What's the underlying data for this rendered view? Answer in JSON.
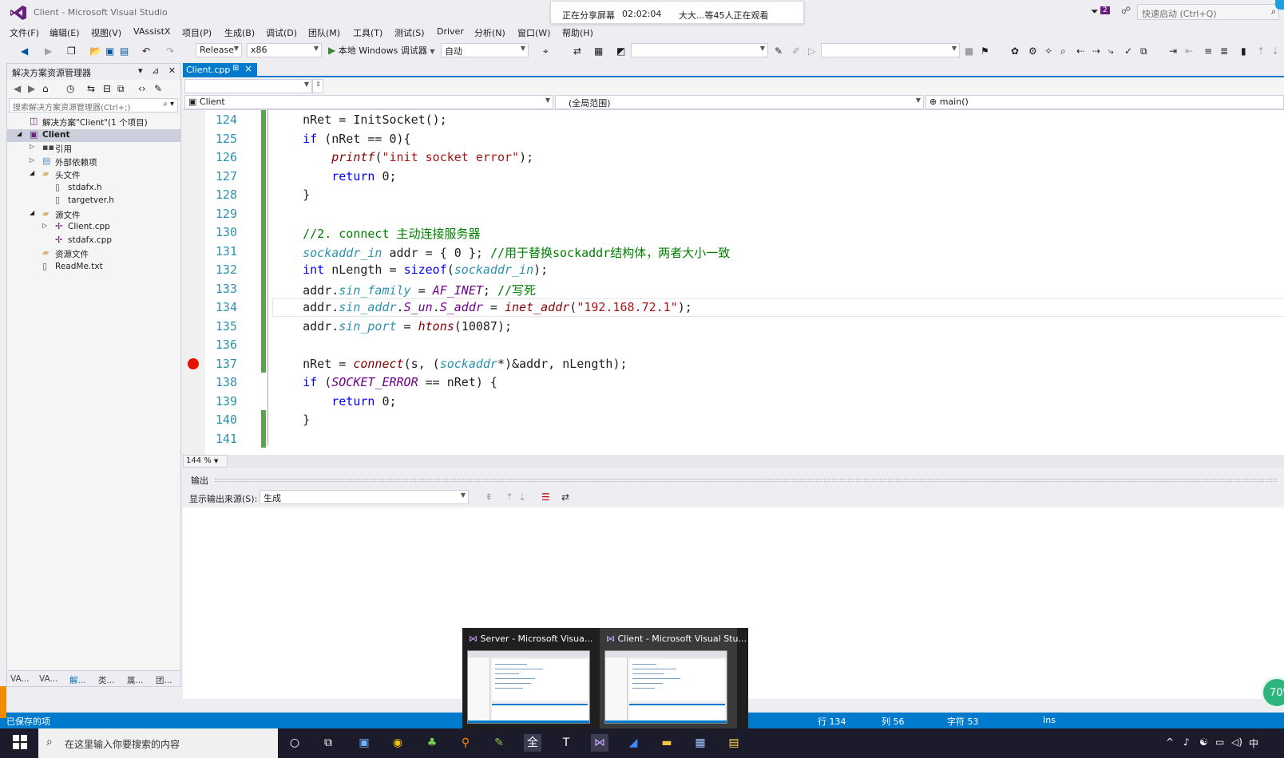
{
  "window": {
    "title": "Client - Microsoft Visual Studio"
  },
  "share_banner": {
    "status": "正在分享屏幕",
    "timer": "02:02:04",
    "viewers": "大大...等45人正在观看"
  },
  "title_right": {
    "notifications": "2",
    "quick_launch_placeholder": "快速启动 (Ctrl+Q)"
  },
  "menu": [
    "文件(F)",
    "编辑(E)",
    "视图(V)",
    "VAssistX",
    "项目(P)",
    "生成(B)",
    "调试(D)",
    "团队(M)",
    "工具(T)",
    "测试(S)",
    "Driver",
    "分析(N)",
    "窗口(W)",
    "帮助(H)"
  ],
  "toolbar": {
    "config": "Release",
    "platform": "x86",
    "debugger": "本地 Windows 调试器",
    "auto": "自动"
  },
  "solution_explorer": {
    "title": "解决方案资源管理器",
    "search_placeholder": "搜索解决方案资源管理器(Ctrl+;)",
    "items": [
      {
        "label": "解决方案\"Client\"(1 个项目)",
        "icon": "solution-icon",
        "level": 0,
        "expander": ""
      },
      {
        "label": "Client",
        "icon": "project-icon",
        "level": 0,
        "expander": "expanded",
        "selected": true,
        "bold": true
      },
      {
        "label": "引用",
        "icon": "references-icon",
        "level": 1,
        "expander": "collapsed"
      },
      {
        "label": "外部依赖项",
        "icon": "external-deps-icon",
        "level": 1,
        "expander": "collapsed"
      },
      {
        "label": "头文件",
        "icon": "folder-icon",
        "level": 1,
        "expander": "expanded"
      },
      {
        "label": "stdafx.h",
        "icon": "header-file-icon",
        "level": 2,
        "expander": ""
      },
      {
        "label": "targetver.h",
        "icon": "header-file-icon",
        "level": 2,
        "expander": ""
      },
      {
        "label": "源文件",
        "icon": "folder-icon",
        "level": 1,
        "expander": "expanded"
      },
      {
        "label": "Client.cpp",
        "icon": "cpp-file-icon",
        "level": 2,
        "expander": "collapsed"
      },
      {
        "label": "stdafx.cpp",
        "icon": "cpp-file-icon",
        "level": 2,
        "expander": ""
      },
      {
        "label": "资源文件",
        "icon": "folder-icon",
        "level": 1,
        "expander": ""
      },
      {
        "label": "ReadMe.txt",
        "icon": "text-file-icon",
        "level": 1,
        "expander": ""
      }
    ],
    "bottom_tabs": [
      "VA...",
      "VA...",
      "解...",
      "类...",
      "属...",
      "团..."
    ]
  },
  "editor": {
    "tab": "Client.cpp",
    "nav_project": "Client",
    "nav_scope": "(全局范围)",
    "nav_member": "main()",
    "zoom": "144 %",
    "lines": [
      {
        "n": "124",
        "changed": true,
        "code": [
          [
            "",
            "    nRet = InitSocket();"
          ]
        ]
      },
      {
        "n": "125",
        "changed": true,
        "code": [
          [
            "kw",
            "    if"
          ],
          [
            "",
            " (nRet == 0){"
          ]
        ]
      },
      {
        "n": "126",
        "changed": true,
        "code": [
          [
            "fn",
            "        printf"
          ],
          [
            "",
            "("
          ],
          [
            "str",
            "\"init socket error\""
          ],
          [
            "",
            ");"
          ]
        ]
      },
      {
        "n": "127",
        "changed": true,
        "code": [
          [
            "kw",
            "        return"
          ],
          [
            "",
            " 0;"
          ]
        ]
      },
      {
        "n": "128",
        "changed": true,
        "code": [
          [
            "",
            "    }"
          ]
        ]
      },
      {
        "n": "129",
        "changed": true,
        "code": [
          [
            "",
            ""
          ]
        ]
      },
      {
        "n": "130",
        "changed": true,
        "code": [
          [
            "cmt",
            "    //2. connect 主动连接服务器"
          ]
        ]
      },
      {
        "n": "131",
        "changed": true,
        "code": [
          [
            "ty",
            "    sockaddr_in"
          ],
          [
            "",
            " addr = { 0 }; "
          ],
          [
            "cmt",
            "//用于替换sockaddr结构体，两者大小一致"
          ]
        ]
      },
      {
        "n": "132",
        "changed": true,
        "code": [
          [
            "kw",
            "    int"
          ],
          [
            "",
            " nLength = "
          ],
          [
            "kw",
            "sizeof"
          ],
          [
            "",
            "("
          ],
          [
            "ty",
            "sockaddr_in"
          ],
          [
            "",
            ");"
          ]
        ]
      },
      {
        "n": "133",
        "changed": true,
        "code": [
          [
            "",
            "    addr."
          ],
          [
            "mem",
            "sin_family"
          ],
          [
            "",
            " = "
          ],
          [
            "mac",
            "AF_INET"
          ],
          [
            "",
            "; "
          ],
          [
            "cmt",
            "//写死"
          ]
        ]
      },
      {
        "n": "134",
        "changed": true,
        "current": true,
        "code": [
          [
            "",
            "    addr."
          ],
          [
            "mem",
            "sin_addr"
          ],
          [
            "",
            "."
          ],
          [
            "mac",
            "S_un"
          ],
          [
            "",
            "."
          ],
          [
            "mac",
            "S_addr"
          ],
          [
            "",
            " = "
          ],
          [
            "fn",
            "inet_addr"
          ],
          [
            "",
            "("
          ],
          [
            "str",
            "\"192.168.72.1\""
          ],
          [
            "",
            ");"
          ]
        ]
      },
      {
        "n": "135",
        "changed": true,
        "code": [
          [
            "",
            "    addr."
          ],
          [
            "mem",
            "sin_port"
          ],
          [
            "",
            " = "
          ],
          [
            "fn",
            "htons"
          ],
          [
            "",
            "(10087);"
          ]
        ]
      },
      {
        "n": "136",
        "changed": true,
        "code": [
          [
            "",
            ""
          ]
        ]
      },
      {
        "n": "137",
        "changed": true,
        "breakpoint": true,
        "code": [
          [
            "",
            "    nRet = "
          ],
          [
            "fn",
            "connect"
          ],
          [
            "",
            "(s, ("
          ],
          [
            "ty",
            "sockaddr"
          ],
          [
            "",
            "*)&addr, nLength);"
          ]
        ]
      },
      {
        "n": "138",
        "changed": false,
        "code": [
          [
            "kw",
            "    if"
          ],
          [
            "",
            " ("
          ],
          [
            "mac",
            "SOCKET_ERROR"
          ],
          [
            "",
            " == nRet) {"
          ]
        ]
      },
      {
        "n": "139",
        "changed": false,
        "code": [
          [
            "kw",
            "        return"
          ],
          [
            "",
            " 0;"
          ]
        ]
      },
      {
        "n": "140",
        "changed": true,
        "code": [
          [
            "",
            "    }"
          ]
        ]
      },
      {
        "n": "141",
        "changed": true,
        "code": [
          [
            "",
            ""
          ]
        ]
      }
    ]
  },
  "output": {
    "title": "输出",
    "source_label": "显示输出来源(S):",
    "source_value": "生成"
  },
  "status": {
    "left": "已保存的项",
    "row": "行 134",
    "col": "列 56",
    "char": "字符 53",
    "mode": "Ins"
  },
  "thumbnails": [
    {
      "title": "Server - Microsoft Visua..."
    },
    {
      "title": "Client - Microsoft Visual Stu..."
    }
  ],
  "perf_badge": "70",
  "taskbar": {
    "search_placeholder": "在这里输入你要搜索的内容",
    "ime": "中"
  },
  "colors": {
    "accent": "#007acc",
    "breakpoint": "#e51400",
    "changed_bar": "#57a64a",
    "vs_purple": "#68217a"
  }
}
